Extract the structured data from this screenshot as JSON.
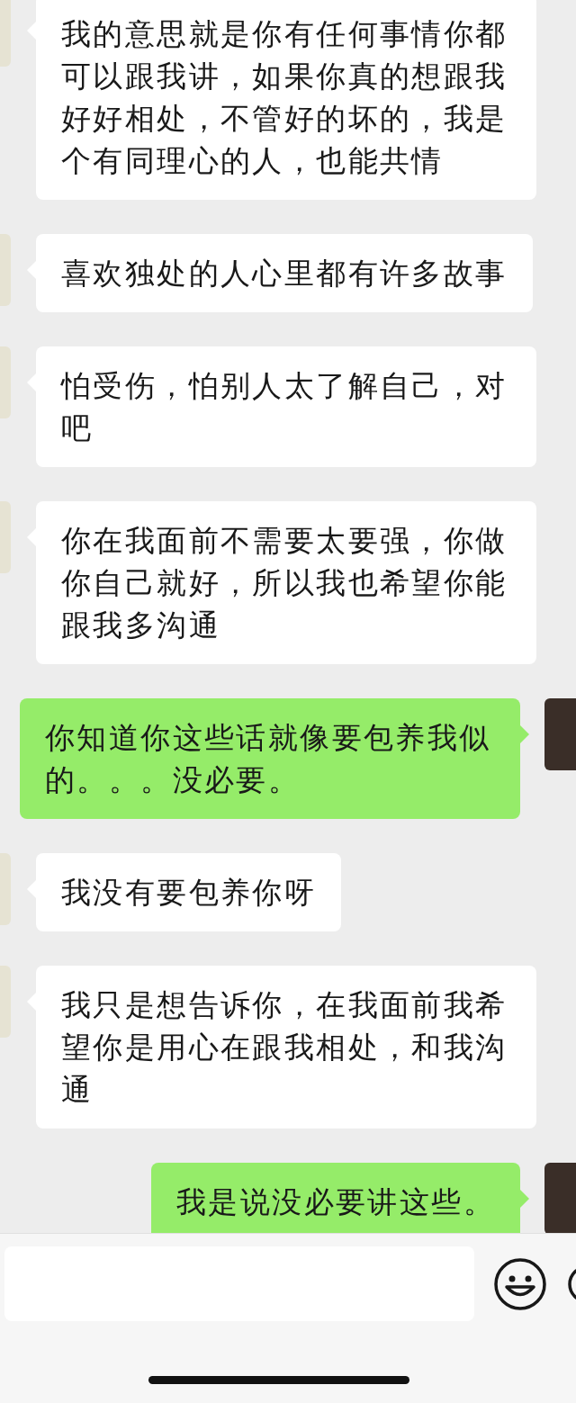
{
  "messages": [
    {
      "kind": "left",
      "text": "我的意思就是你有任何事情你都可以跟我讲，如果你真的想跟我好好相处，不管好的坏的，我是个有同理心的人，也能共情"
    },
    {
      "kind": "left",
      "text": "喜欢独处的人心里都有许多故事"
    },
    {
      "kind": "left",
      "text": "怕受伤，怕别人太了解自己，对吧"
    },
    {
      "kind": "left",
      "text": "你在我面前不需要太要强，你做你自己就好，所以我也希望你能跟我多沟通"
    },
    {
      "kind": "right",
      "text": "你知道你这些话就像要包养我似的。。。没必要。"
    },
    {
      "kind": "left",
      "text": "我没有要包养你呀"
    },
    {
      "kind": "left",
      "text": "我只是想告诉你，在我面前我希望你是用心在跟我相处，和我沟通"
    },
    {
      "kind": "right",
      "text": "我是说没必要讲这些。"
    }
  ]
}
